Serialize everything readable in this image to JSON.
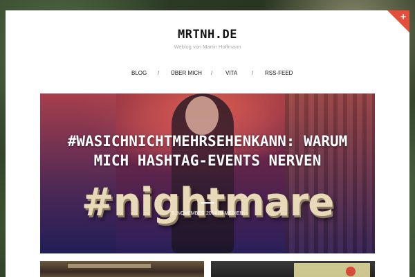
{
  "site": {
    "title": "MRTNH.DE",
    "description": "Weblog von Martin Hoffmann",
    "corner_icon": "plus-icon",
    "corner_symbol": "+"
  },
  "nav": {
    "items": [
      "BLOG",
      "ÜBER MICH",
      "VITA",
      "RSS-FEED"
    ],
    "separator": "/"
  },
  "featured_post": {
    "title": "#WASICHNICHTMEHRSEHENKANN: WARUM MICH HASHTAG-EVENTS NERVEN",
    "image_text": "#nightmare",
    "date": "5. NOVEMBER 2014",
    "in_label": "IN",
    "category": "MEDIEN"
  },
  "colors": {
    "accent": "#e54e3a",
    "page_background": "#ffffff",
    "title_text": "#111111",
    "description_text": "#aaaaaa"
  }
}
